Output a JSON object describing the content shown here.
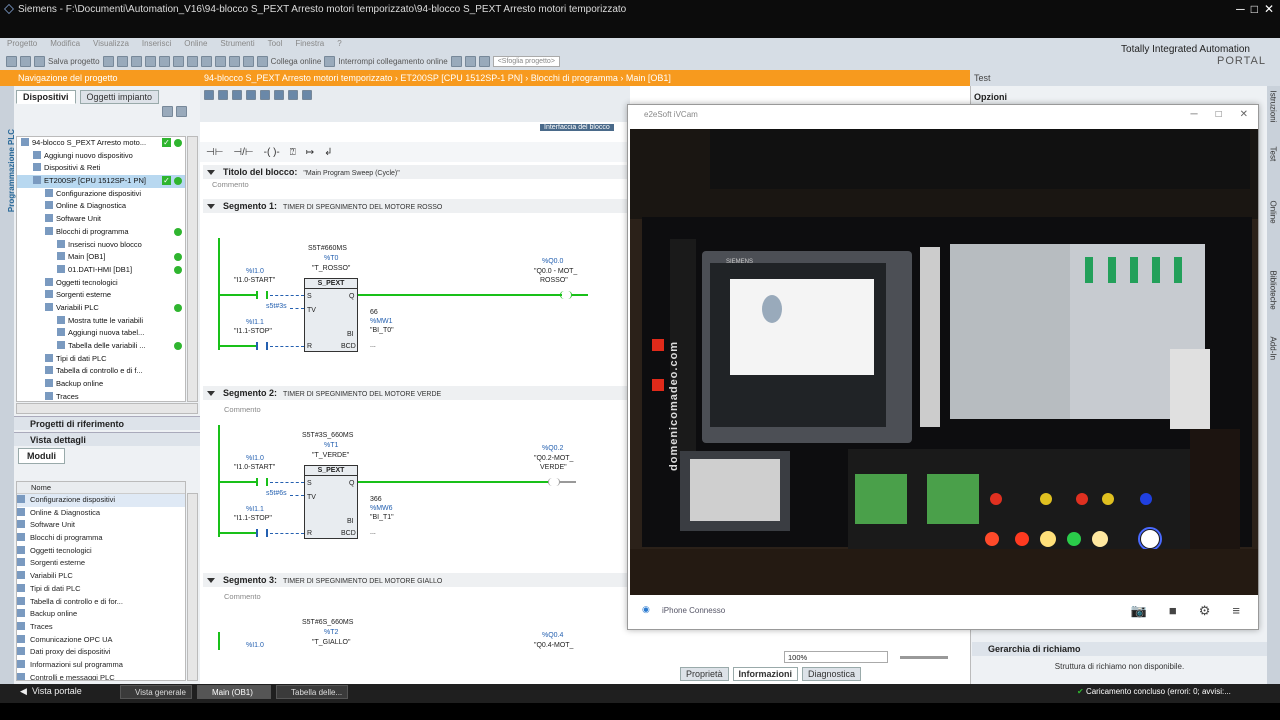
{
  "window": {
    "title": "Siemens  -  F:\\Documenti\\Automation_V16\\94-blocco S_PEXT Arresto motori temporizzato\\94-blocco S_PEXT Arresto motori temporizzato"
  },
  "menu": [
    "Progetto",
    "Modifica",
    "Visualizza",
    "Inserisci",
    "Online",
    "Strumenti",
    "Tool",
    "Finestra",
    "?"
  ],
  "brand": {
    "line1": "Totally Integrated Automation",
    "line2": "PORTAL"
  },
  "toolbar": {
    "save_label": "Salva progetto",
    "connect_label": "Collega online",
    "disconnect_label": "Interrompi collegamento online",
    "search_placeholder": "<Sfoglia progetto>"
  },
  "left": {
    "title": "Navigazione del progetto",
    "vertical_label": "Programmazione PLC",
    "tab_devices": "Dispositivi",
    "tab_plant": "Oggetti impianto",
    "tree": [
      {
        "label": "94-blocco S_PEXT Arresto moto...",
        "indent": 0,
        "check": true,
        "ok": true
      },
      {
        "label": "Aggiungi nuovo dispositivo",
        "indent": 1
      },
      {
        "label": "Dispositivi & Reti",
        "indent": 1
      },
      {
        "label": "ET200SP [CPU 1512SP-1 PN]",
        "indent": 1,
        "check": true,
        "ok": true,
        "sel": true
      },
      {
        "label": "Configurazione dispositivi",
        "indent": 2
      },
      {
        "label": "Online & Diagnostica",
        "indent": 2
      },
      {
        "label": "Software Unit",
        "indent": 2
      },
      {
        "label": "Blocchi di programma",
        "indent": 2,
        "ok": true
      },
      {
        "label": "Inserisci nuovo blocco",
        "indent": 3
      },
      {
        "label": "Main [OB1]",
        "indent": 3,
        "ok": true
      },
      {
        "label": "01.DATI-HMI [DB1]",
        "indent": 3,
        "ok": true
      },
      {
        "label": "Oggetti tecnologici",
        "indent": 2
      },
      {
        "label": "Sorgenti esterne",
        "indent": 2
      },
      {
        "label": "Variabili PLC",
        "indent": 2,
        "ok": true
      },
      {
        "label": "Mostra tutte le variabili",
        "indent": 3
      },
      {
        "label": "Aggiungi nuova tabel...",
        "indent": 3
      },
      {
        "label": "Tabella delle variabili ...",
        "indent": 3,
        "ok": true
      },
      {
        "label": "Tipi di dati PLC",
        "indent": 2
      },
      {
        "label": "Tabella di controllo e di f...",
        "indent": 2
      },
      {
        "label": "Backup online",
        "indent": 2
      },
      {
        "label": "Traces",
        "indent": 2
      }
    ],
    "ref_projects": "Progetti di riferimento",
    "details_view": "Vista dettagli",
    "modules_tab": "Moduli",
    "col_name": "Nome",
    "modules": [
      "Configurazione dispositivi",
      "Online & Diagnostica",
      "Software Unit",
      "Blocchi di programma",
      "Oggetti tecnologici",
      "Sorgenti esterne",
      "Variabili PLC",
      "Tipi di dati PLC",
      "Tabella di controllo e di for...",
      "Backup online",
      "Traces",
      "Comunicazione OPC UA",
      "Dati proxy dei dispositivi",
      "Informazioni sul programma",
      "Controlli e messaggi PLC"
    ]
  },
  "editor": {
    "breadcrumb": "94-blocco S_PEXT Arresto motori temporizzato  ›  ET200SP [CPU 1512SP-1 PN]  ›  Blocchi di programma  ›  Main [OB1]",
    "interface_label": "Interfaccia del blocco",
    "block_title_label": "Titolo del blocco:",
    "block_title": "\"Main Program Sweep (Cycle)\"",
    "comment": "Commento",
    "segments": [
      {
        "label": "Segmento 1:",
        "title": "TIMER DI SPEGNIMENTO DEL MOTORE ROSSO",
        "timer_val": "S5T#660MS",
        "timer_addr": "%T0",
        "timer_name": "\"T_ROSSO\"",
        "block": "S_PEXT",
        "in1_addr": "%I1.0",
        "in1_name": "\"I1.0-START\"",
        "tv": "s5t#3s",
        "in2_addr": "%I1.1",
        "in2_name": "\"I1.1-STOP\"",
        "bi_val": "66",
        "bi_addr": "%MW1",
        "bi_name": "\"BI_T0\"",
        "out_addr": "%Q0.0",
        "out_name1": "\"Q0.0 - MOT_",
        "out_name2": "ROSSO\""
      },
      {
        "label": "Segmento 2:",
        "title": "TIMER DI SPEGNIMENTO DEL MOTORE VERDE",
        "timer_val": "S5T#3S_660MS",
        "timer_addr": "%T1",
        "timer_name": "\"T_VERDE\"",
        "block": "S_PEXT",
        "in1_addr": "%I1.0",
        "in1_name": "\"I1.0-START\"",
        "tv": "s5t#6s",
        "in2_addr": "%I1.1",
        "in2_name": "\"I1.1-STOP\"",
        "bi_val": "366",
        "bi_addr": "%MW6",
        "bi_name": "\"BI_T1\"",
        "out_addr": "%Q0.2",
        "out_name1": "\"Q0.2-MOT_",
        "out_name2": "VERDE\""
      },
      {
        "label": "Segmento 3:",
        "title": "TIMER DI SPEGNIMENTO DEL MOTORE GIALLO",
        "timer_val": "S5T#6S_660MS",
        "timer_addr": "%T2",
        "timer_name": "\"T_GIALLO\"",
        "in1_addr": "%I1.0",
        "out_addr": "%Q0.4",
        "out_name1": "\"Q0.4-MOT_"
      }
    ],
    "zoom": "100%",
    "tab_properties": "Proprietà",
    "tab_info": "Informazioni",
    "tab_diag": "Diagnostica"
  },
  "webcam": {
    "title": "e2eSoft iVCam",
    "status": "iPhone Connesso",
    "brand_text": "domenicomadeo.com",
    "panel_text": "SIEMENS"
  },
  "test": {
    "title": "Test",
    "options": "Opzioni",
    "call_hierarchy": "Gerarchia di richiamo",
    "call_none": "Struttura di richiamo non disponibile.",
    "side_tabs": [
      "Istruzioni",
      "Test",
      "Online",
      "Biblioteche",
      "Add-In"
    ]
  },
  "statusbar": {
    "portal": "Vista portale",
    "tabs": [
      "Vista generale",
      "Main (OB1)",
      "Tabella delle..."
    ],
    "message": "Caricamento concluso (errori: 0; avvisi:..."
  }
}
